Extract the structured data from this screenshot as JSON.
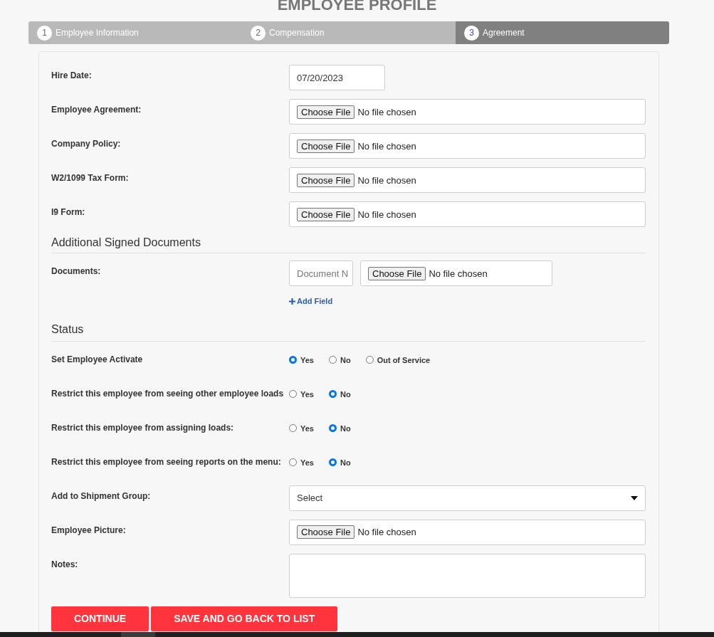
{
  "title": "EMPLOYEE PROFILE",
  "steps": [
    {
      "number": "1",
      "label": "Employee Information",
      "selected": false
    },
    {
      "number": "2",
      "label": "Compensation",
      "selected": false
    },
    {
      "number": "3",
      "label": "Agreement",
      "selected": true
    }
  ],
  "fields": [
    {
      "kind": "date",
      "label": "Hire Date:",
      "value": "07/20/2023"
    },
    {
      "kind": "file",
      "label": "Employee Agreement:",
      "button": "Choose File",
      "file": "No file chosen"
    },
    {
      "kind": "file",
      "label": "Company Policy:",
      "button": "Choose File",
      "file": "No file chosen"
    },
    {
      "kind": "file",
      "label": "W2/1099 Tax Form:",
      "button": "Choose File",
      "file": "No file chosen"
    },
    {
      "kind": "file",
      "label": "I9 Form:",
      "button": "Choose File",
      "file": "No file chosen"
    }
  ],
  "sections": [
    {
      "heading": "Additional Signed Documents",
      "fields": [
        {
          "kind": "document",
          "label": "Documents:",
          "placeholder": "Document N",
          "button": "Choose File",
          "file": "No file chosen",
          "add_link": "Add Field"
        }
      ]
    },
    {
      "heading": "Status",
      "fields": [
        {
          "kind": "radio",
          "label": "Set Employee Activate",
          "options": [
            {
              "label": "Yes",
              "selected": true
            },
            {
              "label": "No",
              "selected": false
            },
            {
              "label": "Out of Service",
              "selected": false
            }
          ]
        },
        {
          "kind": "radio",
          "label": "Restrict this employee from seeing other employee loads",
          "options": [
            {
              "label": "Yes",
              "selected": false
            },
            {
              "label": "No",
              "selected": true
            }
          ]
        },
        {
          "kind": "radio",
          "label": "Restrict this employee from assigning loads:",
          "options": [
            {
              "label": "Yes",
              "selected": false
            },
            {
              "label": "No",
              "selected": true
            }
          ]
        },
        {
          "kind": "radio",
          "label": "Restrict this employee from seeing reports on the menu:",
          "options": [
            {
              "label": "Yes",
              "selected": false
            },
            {
              "label": "No",
              "selected": true
            }
          ]
        },
        {
          "kind": "select",
          "label": "Add to Shipment Group:",
          "value": "Select"
        },
        {
          "kind": "file",
          "label": "Employee Picture:",
          "button": "Choose File",
          "file": "No file chosen"
        },
        {
          "kind": "textarea",
          "label": "Notes:"
        }
      ]
    }
  ],
  "buttons": [
    "CONTINUE",
    "SAVE AND GO BACK TO LIST"
  ]
}
